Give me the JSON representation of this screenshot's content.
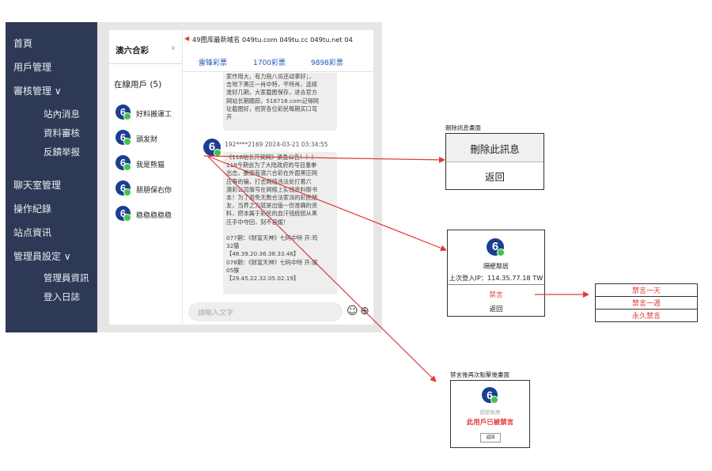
{
  "sidebar": {
    "items": [
      {
        "label": "首頁"
      },
      {
        "label": "用戶管理"
      },
      {
        "label": "審核管理 ∨"
      },
      {
        "label": "站內消息"
      },
      {
        "label": "資料審核"
      },
      {
        "label": "反饋举报"
      },
      {
        "label": "聊天室管理"
      },
      {
        "label": "操作紀錄"
      },
      {
        "label": "站点資讯"
      },
      {
        "label": "管理員設定 ∨"
      },
      {
        "label": "管理員資訊"
      },
      {
        "label": "登入日誌"
      }
    ]
  },
  "room_selector": {
    "value": "澳六合彩",
    "chevron": "∨"
  },
  "online_users": {
    "title": "在線用戶 (5)",
    "users": [
      "好料搬運工",
      "頭发财",
      "我是熊猫",
      "朋朋保右你",
      "稳稳稳稳稳"
    ]
  },
  "announcement": {
    "text": "49图库最新域名 049tu.com 049tu.cc 049tu.net 04"
  },
  "lottery_links": [
    "雷锋彩票",
    "1700彩票",
    "9898彩票"
  ],
  "messages": {
    "first_lines": [
      "家作用大，有力指八派还动事好；，",
      "击地下黑庄一肖中特，平特肖，连续",
      "准好几期，大家截图保存，进去官方",
      "网站长期跟踪，518718.com记得网",
      "址截图好，祝贺各位彩民每期买口弯",
      "开"
    ],
    "second_header": "192****2169  2024-03-21 03:34:55",
    "second_lines": [
      "《118站长开奖网》紧急公告！！！",
      "118今期会为了大陆政府的号目重拳",
      "出击，酬谢有澳六合彩在外面黑庄网",
      "庄等的骗，打击网络违法处打着六",
      "澳彩公司旗号在网络上实钱资料假书",
      "本！为了避免无数合法家派的彩民朋",
      "友，当养之为就是出版一份准确的资",
      "料，把本属于彩民的血汗钱统统从黑",
      "庄手中夺回，刻不容缓！",
      "",
      "077期：《财富天神》七码中特 开:鸡",
      "32猫",
      "【48.39.20.36.38.33.46】",
      "078期：《财富天神》七码中特 开:猴",
      "05猴",
      "【29.45.22.32.05.02.19】"
    ]
  },
  "chat_input": {
    "placeholder": "請輸入文字",
    "emoji": "☺",
    "plus": "⊕"
  },
  "avatar_logo": "6",
  "delete_popup": {
    "caption": "刪除訊息畫面",
    "delete_label": "刪除此訊息",
    "back_label": "返回"
  },
  "user_popup": {
    "name": "隔壁鄰居",
    "last_login": "上次登入IP：114.35.77.18 TW",
    "ban_label": "禁言",
    "back_label": "返回"
  },
  "ban_options": [
    "禁言一天",
    "禁言一週",
    "永久禁言"
  ],
  "banned_popup": {
    "caption": "禁言後再次點擊後畫面",
    "name": "隔壁鄰居",
    "status": "此用戶已被禁言",
    "back_label": "返回"
  },
  "colors": {
    "sidebar_bg": "#2e3a55",
    "accent_blue": "#1f55b5",
    "logo_blue": "#1a3f8f",
    "logo_green": "#3ec44a",
    "arrow_red": "#e53935"
  }
}
